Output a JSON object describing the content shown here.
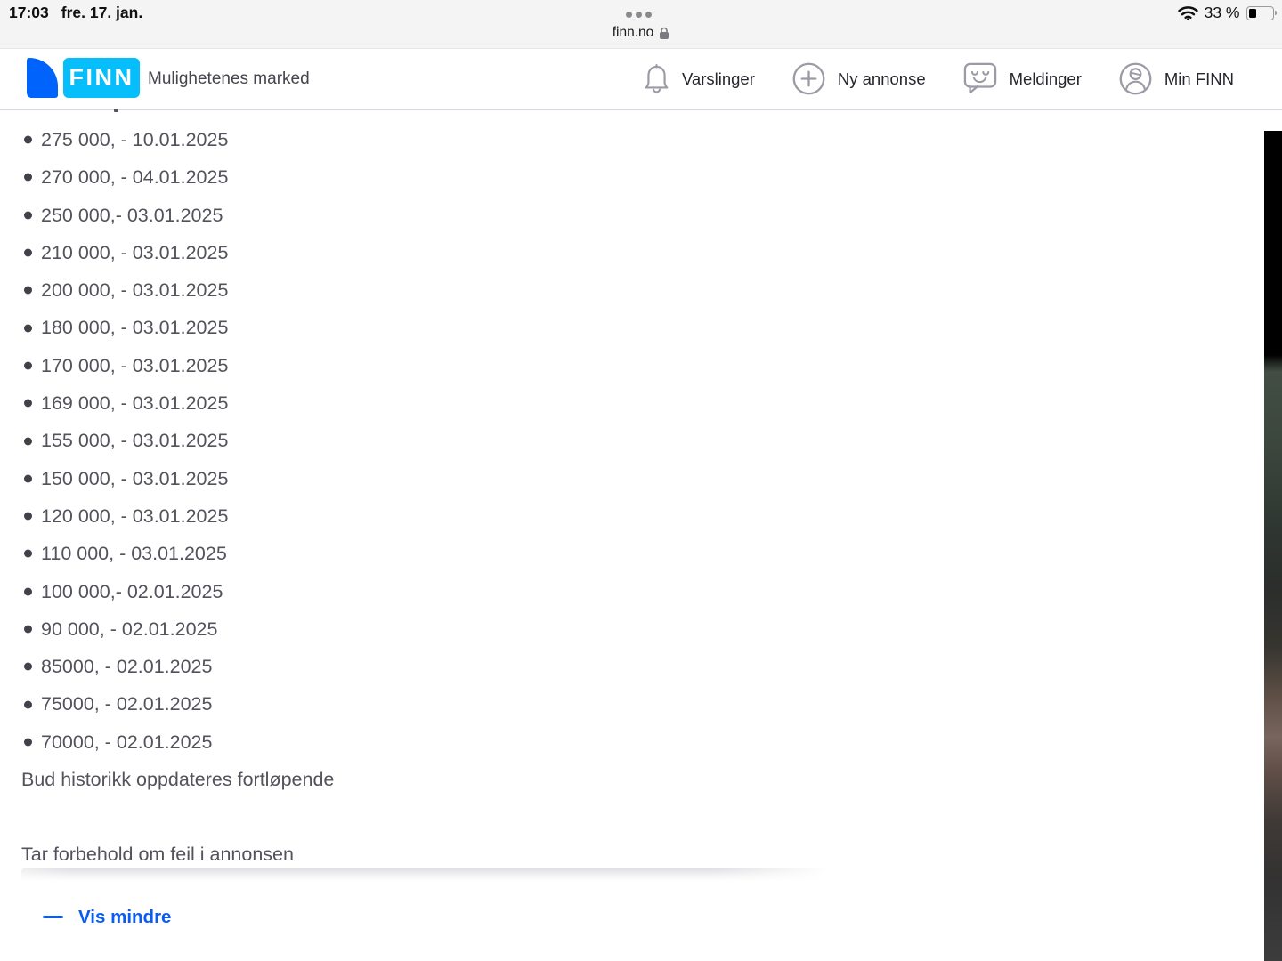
{
  "status_bar": {
    "time": "17:03",
    "date": "fre. 17. jan.",
    "battery_percent": "33 %",
    "url": "finn.no"
  },
  "header": {
    "logo": "FINN",
    "tagline": "Mulighetenes marked",
    "nav": [
      {
        "label": "Varslinger",
        "icon": "bell-icon"
      },
      {
        "label": "Ny annonse",
        "icon": "plus-circle-icon"
      },
      {
        "label": "Meldinger",
        "icon": "chat-smiley-icon"
      },
      {
        "label": "Min FINN",
        "icon": "person-circle-icon"
      }
    ]
  },
  "bids": {
    "items": [
      "275 000, - 10.01.2025",
      "270 000, - 04.01.2025",
      "250 000,- 03.01.2025",
      "210 000, - 03.01.2025",
      "200 000, - 03.01.2025",
      "180 000, - 03.01.2025",
      "170 000, - 03.01.2025",
      "169 000, - 03.01.2025",
      "155 000, - 03.01.2025",
      "150 000, - 03.01.2025",
      "120 000, - 03.01.2025",
      "110 000, - 03.01.2025",
      "100 000,- 02.01.2025",
      "90 000, - 02.01.2025",
      "85000, - 02.01.2025",
      "75000, - 02.01.2025",
      "70000, - 02.01.2025"
    ],
    "note": "Bud historikk oppdateres fortløpende",
    "disclaimer": "Tar forbehold om feil i annonsen",
    "collapse_label": "Vis mindre"
  },
  "colors": {
    "brand_blue": "#0063fb",
    "brand_cyan": "#06befb",
    "link_blue": "#0b5cf5",
    "text_gray": "#53535c",
    "statusbar_bg": "#f4f4f5"
  }
}
